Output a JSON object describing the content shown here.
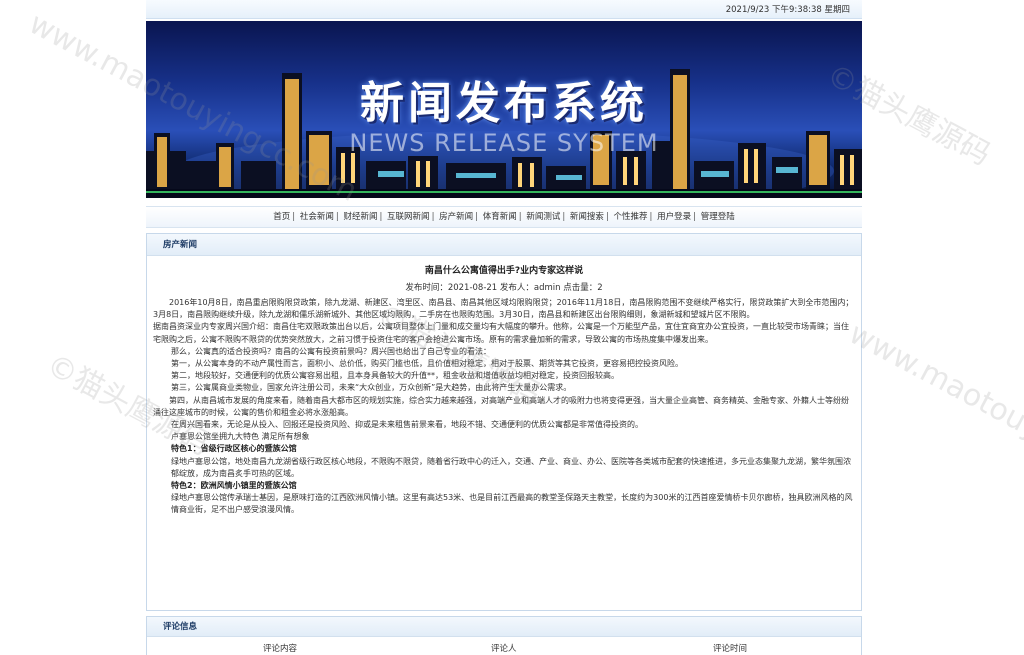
{
  "datetime": "2021/9/23 下午9:38:38 星期四",
  "banner": {
    "title": "新闻发布系统",
    "subtitle": "NEWS RELEASE SYSTEM"
  },
  "nav": [
    "首页",
    "社会新闻",
    "财经新闻",
    "互联网新闻",
    "房产新闻",
    "体育新闻",
    "新闻测试",
    "新闻搜索",
    "个性推荐",
    "用户登录",
    "管理登陆"
  ],
  "section_title": "房产新闻",
  "article": {
    "title": "南昌什么公寓值得出手?业内专家这样说",
    "meta": "发布时间：2021-08-21 发布人：admin 点击量：2",
    "paragraphs": [
      "2016年10月8日，南昌重启限购限贷政策，除九龙湖、新建区、湾里区、南昌县、南昌其他区域均限购限贷；2016年11月18日，南昌限购范围不变继续严格实行，限贷政策扩大到全市范围内；3月8日，南昌限购继续升级，除九龙湖和儒乐湖新城外、其他区域均限购，二手房在也限购范围。3月30日，南昌县和新建区出台限购细则，象湖新城和望城片区不限购。",
      "据南昌资深业内专家周兴国介绍：南昌住宅双限政策出台以后，公寓项目整体上门量和成交量均有大幅度的攀升。他称，公寓是一个万能型产品，宜住宜商宜办公宜投资，一直比较受市场青睐；当住宅限购之后，公寓不限购不限贷的优势突然放大，之前习惯于投资住宅的客户会抢进公寓市场。原有的需求叠加新的需求，导致公寓的市场热度集中爆发出来。",
      "那么，公寓真的适合投资吗？南昌的公寓有投资前景吗？周兴国也给出了自己专业的看法：",
      "第一，从公寓本身的不动产属性而言，面积小、总价低，购买门槛也低，且价值相对稳定，相对于股票、期货等其它投资，更容易把控投资风险。",
      "第二，地段较好，交通便利的优质公寓容易出租，且本身具备较大的升值**，租金收益和增值收益均相对稳定，投资回报较高。",
      "第三，公寓属商业类物业，国家允许注册公司，未来“大众创业，万众创新”是大趋势，由此将产生大量办公需求。",
      "第四，从南昌城市发展的角度来看，随着南昌大都市区的规划实施，综合实力越来越强，对高端产业和高端人才的吸附力也将变得更强，当大量企业高管、商务精英、金融专家、外籍人士等纷纷涌往这座城市的时候，公寓的售价和租金必将水涨船高。",
      "在周兴国看来，无论是从投入、回报还是投资风险、抑或是未来租售前景来看，地段不错、交通便利的优质公寓都是非常值得投资的。",
      "卢塞恩公馆坐拥九大特色 满足所有想象",
      "特色1：省级行政区核心的暨族公馆",
      "绿地卢塞恩公馆，地处南昌九龙湖省级行政区核心地段，不限购不限贷，随着省行政中心的迁入，交通、产业、商业、办公、医院等各类城市配套的快速推进，多元业态集聚九龙湖，繁华氛围浓郁绽放，成为南昌炙手可热的区域。",
      "特色2：欧洲风情小镇里的暨族公馆",
      "绿地卢塞恩公馆传承瑞士基因，是原味打造的江西欧洲风情小镇。这里有高达53米、也是目前江西最高的教堂圣保路天主教堂，长度约为300米的江西首座爱情桥卡贝尔廊桥，独具欧洲风格的风情商业街，足不出户感受浪漫风情。"
    ]
  },
  "comments": {
    "title": "评论信息",
    "columns": [
      "评论内容",
      "评论人",
      "评论时间"
    ]
  },
  "watermark": {
    "brand": "©猫头鹰源码",
    "url": "www.maotouyingcc.com"
  }
}
